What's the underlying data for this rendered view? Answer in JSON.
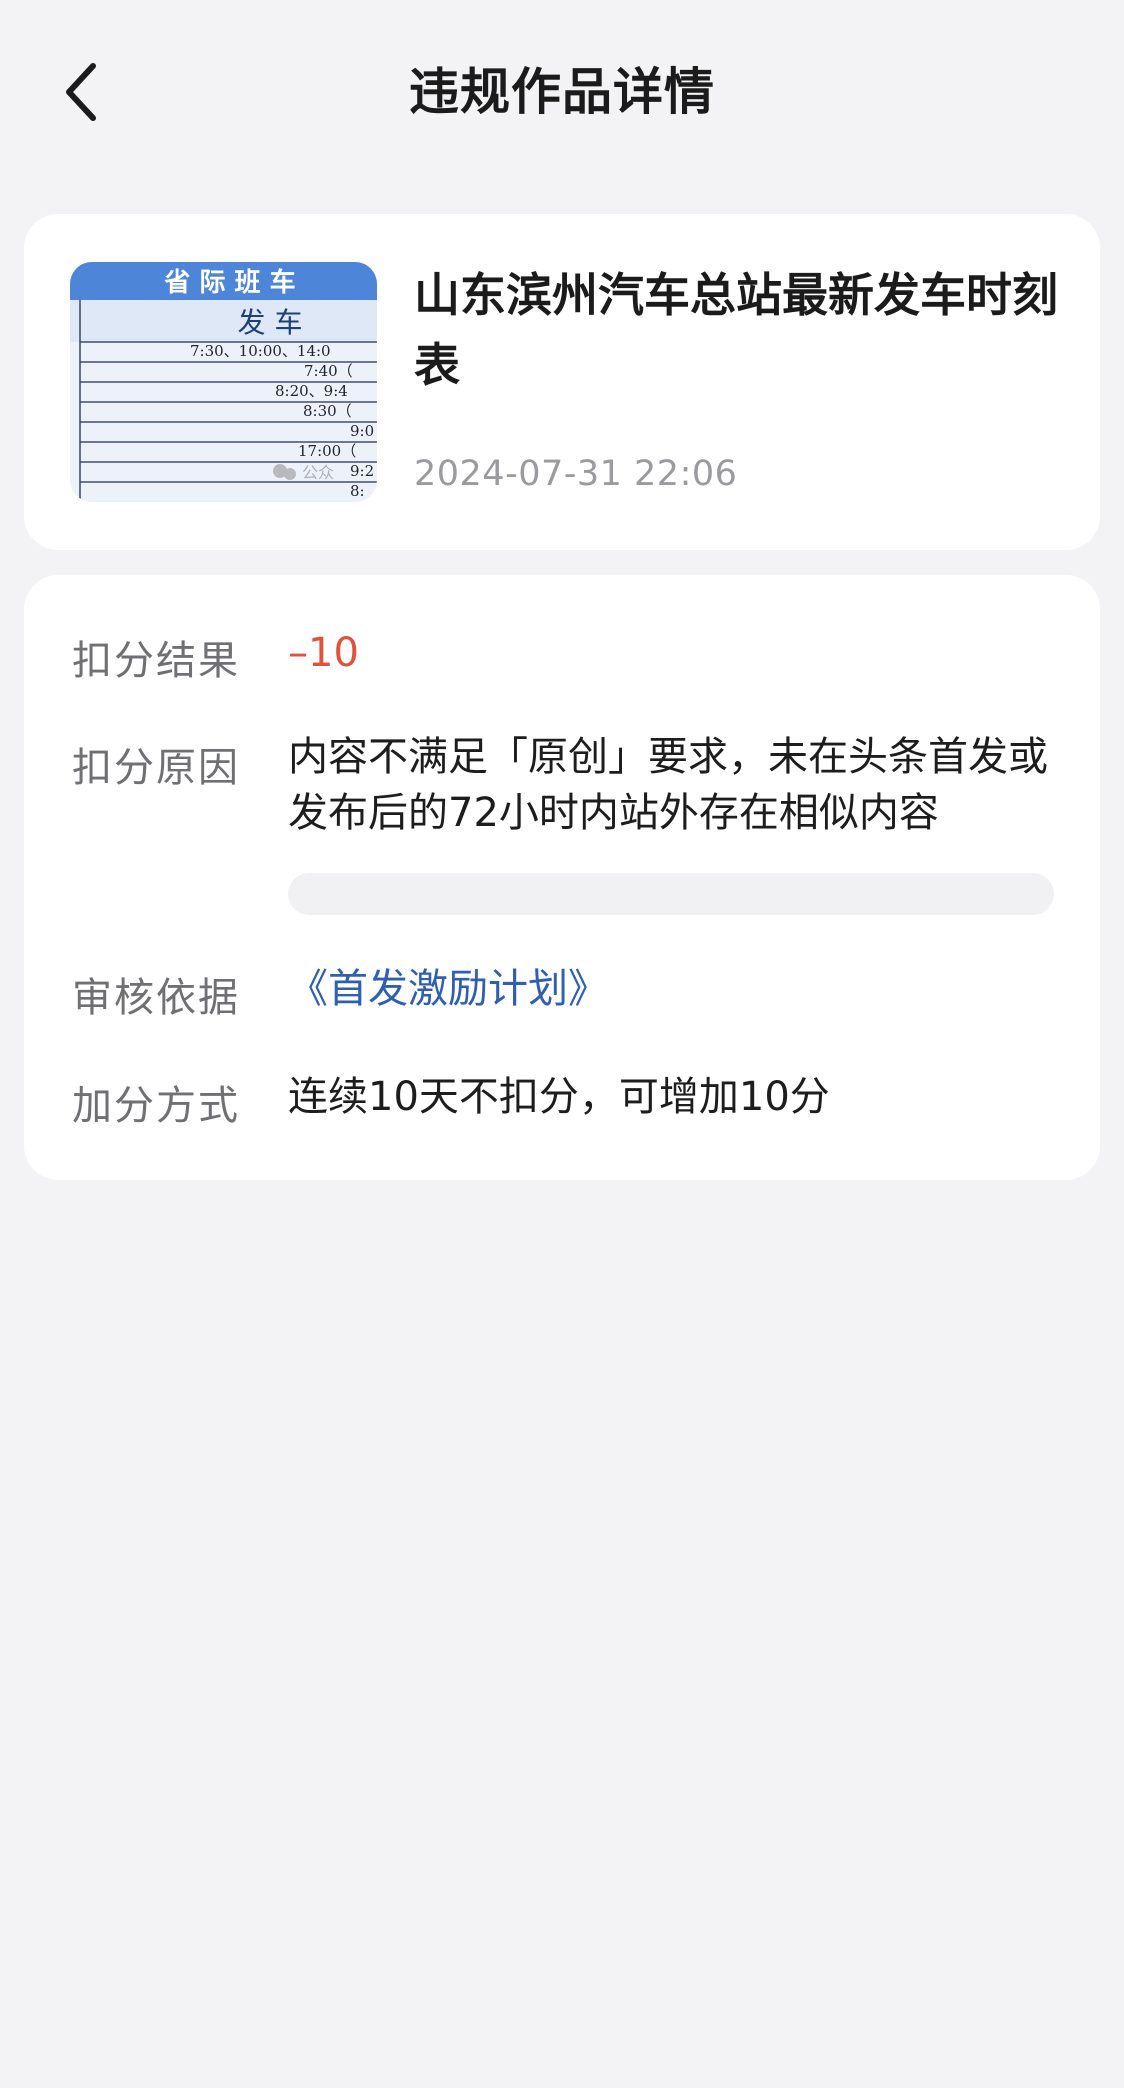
{
  "header": {
    "title": "违规作品详情"
  },
  "article": {
    "title": "山东滨州汽车总站最新发车时刻表",
    "time": "2024-07-31 22:06",
    "thumbnail": {
      "heading": "省 际 班 车",
      "subheading": "发 车",
      "lines": [
        "7:30、10:00、14:0",
        "7:40（",
        "8:20、9:4",
        "8:30（",
        "9:0",
        "17:00（",
        "9:2",
        "8:"
      ],
      "watermark": "公众"
    }
  },
  "details": {
    "result_label": "扣分结果",
    "result_value": "–10",
    "reason_label": "扣分原因",
    "reason_value": "内容不满足「原创」要求，未在头条首发或发布后的72小时内站外存在相似内容",
    "basis_label": "审核依据",
    "basis_value": "《首发激励计划》",
    "method_label": "加分方式",
    "method_value": "连续10天不扣分，可增加10分"
  },
  "colors": {
    "penalty": "#e0533a",
    "link": "#2e5fb0",
    "background": "#f3f3f5"
  }
}
